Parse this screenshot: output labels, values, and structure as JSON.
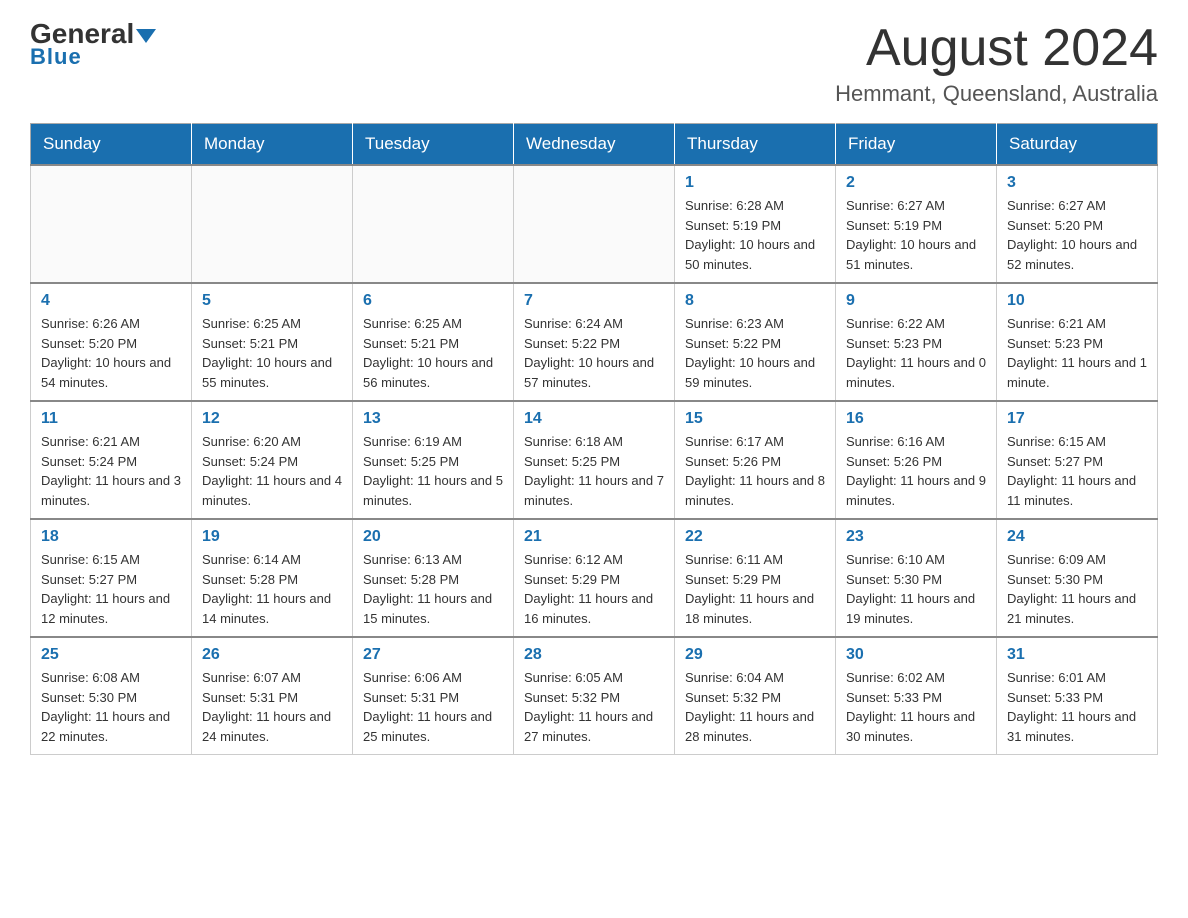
{
  "header": {
    "logo_general": "General",
    "logo_blue": "Blue",
    "month_title": "August 2024",
    "location": "Hemmant, Queensland, Australia"
  },
  "days_of_week": [
    "Sunday",
    "Monday",
    "Tuesday",
    "Wednesday",
    "Thursday",
    "Friday",
    "Saturday"
  ],
  "weeks": [
    [
      {
        "day": "",
        "sunrise": "",
        "sunset": "",
        "daylight": ""
      },
      {
        "day": "",
        "sunrise": "",
        "sunset": "",
        "daylight": ""
      },
      {
        "day": "",
        "sunrise": "",
        "sunset": "",
        "daylight": ""
      },
      {
        "day": "",
        "sunrise": "",
        "sunset": "",
        "daylight": ""
      },
      {
        "day": "1",
        "sunrise": "Sunrise: 6:28 AM",
        "sunset": "Sunset: 5:19 PM",
        "daylight": "Daylight: 10 hours and 50 minutes."
      },
      {
        "day": "2",
        "sunrise": "Sunrise: 6:27 AM",
        "sunset": "Sunset: 5:19 PM",
        "daylight": "Daylight: 10 hours and 51 minutes."
      },
      {
        "day": "3",
        "sunrise": "Sunrise: 6:27 AM",
        "sunset": "Sunset: 5:20 PM",
        "daylight": "Daylight: 10 hours and 52 minutes."
      }
    ],
    [
      {
        "day": "4",
        "sunrise": "Sunrise: 6:26 AM",
        "sunset": "Sunset: 5:20 PM",
        "daylight": "Daylight: 10 hours and 54 minutes."
      },
      {
        "day": "5",
        "sunrise": "Sunrise: 6:25 AM",
        "sunset": "Sunset: 5:21 PM",
        "daylight": "Daylight: 10 hours and 55 minutes."
      },
      {
        "day": "6",
        "sunrise": "Sunrise: 6:25 AM",
        "sunset": "Sunset: 5:21 PM",
        "daylight": "Daylight: 10 hours and 56 minutes."
      },
      {
        "day": "7",
        "sunrise": "Sunrise: 6:24 AM",
        "sunset": "Sunset: 5:22 PM",
        "daylight": "Daylight: 10 hours and 57 minutes."
      },
      {
        "day": "8",
        "sunrise": "Sunrise: 6:23 AM",
        "sunset": "Sunset: 5:22 PM",
        "daylight": "Daylight: 10 hours and 59 minutes."
      },
      {
        "day": "9",
        "sunrise": "Sunrise: 6:22 AM",
        "sunset": "Sunset: 5:23 PM",
        "daylight": "Daylight: 11 hours and 0 minutes."
      },
      {
        "day": "10",
        "sunrise": "Sunrise: 6:21 AM",
        "sunset": "Sunset: 5:23 PM",
        "daylight": "Daylight: 11 hours and 1 minute."
      }
    ],
    [
      {
        "day": "11",
        "sunrise": "Sunrise: 6:21 AM",
        "sunset": "Sunset: 5:24 PM",
        "daylight": "Daylight: 11 hours and 3 minutes."
      },
      {
        "day": "12",
        "sunrise": "Sunrise: 6:20 AM",
        "sunset": "Sunset: 5:24 PM",
        "daylight": "Daylight: 11 hours and 4 minutes."
      },
      {
        "day": "13",
        "sunrise": "Sunrise: 6:19 AM",
        "sunset": "Sunset: 5:25 PM",
        "daylight": "Daylight: 11 hours and 5 minutes."
      },
      {
        "day": "14",
        "sunrise": "Sunrise: 6:18 AM",
        "sunset": "Sunset: 5:25 PM",
        "daylight": "Daylight: 11 hours and 7 minutes."
      },
      {
        "day": "15",
        "sunrise": "Sunrise: 6:17 AM",
        "sunset": "Sunset: 5:26 PM",
        "daylight": "Daylight: 11 hours and 8 minutes."
      },
      {
        "day": "16",
        "sunrise": "Sunrise: 6:16 AM",
        "sunset": "Sunset: 5:26 PM",
        "daylight": "Daylight: 11 hours and 9 minutes."
      },
      {
        "day": "17",
        "sunrise": "Sunrise: 6:15 AM",
        "sunset": "Sunset: 5:27 PM",
        "daylight": "Daylight: 11 hours and 11 minutes."
      }
    ],
    [
      {
        "day": "18",
        "sunrise": "Sunrise: 6:15 AM",
        "sunset": "Sunset: 5:27 PM",
        "daylight": "Daylight: 11 hours and 12 minutes."
      },
      {
        "day": "19",
        "sunrise": "Sunrise: 6:14 AM",
        "sunset": "Sunset: 5:28 PM",
        "daylight": "Daylight: 11 hours and 14 minutes."
      },
      {
        "day": "20",
        "sunrise": "Sunrise: 6:13 AM",
        "sunset": "Sunset: 5:28 PM",
        "daylight": "Daylight: 11 hours and 15 minutes."
      },
      {
        "day": "21",
        "sunrise": "Sunrise: 6:12 AM",
        "sunset": "Sunset: 5:29 PM",
        "daylight": "Daylight: 11 hours and 16 minutes."
      },
      {
        "day": "22",
        "sunrise": "Sunrise: 6:11 AM",
        "sunset": "Sunset: 5:29 PM",
        "daylight": "Daylight: 11 hours and 18 minutes."
      },
      {
        "day": "23",
        "sunrise": "Sunrise: 6:10 AM",
        "sunset": "Sunset: 5:30 PM",
        "daylight": "Daylight: 11 hours and 19 minutes."
      },
      {
        "day": "24",
        "sunrise": "Sunrise: 6:09 AM",
        "sunset": "Sunset: 5:30 PM",
        "daylight": "Daylight: 11 hours and 21 minutes."
      }
    ],
    [
      {
        "day": "25",
        "sunrise": "Sunrise: 6:08 AM",
        "sunset": "Sunset: 5:30 PM",
        "daylight": "Daylight: 11 hours and 22 minutes."
      },
      {
        "day": "26",
        "sunrise": "Sunrise: 6:07 AM",
        "sunset": "Sunset: 5:31 PM",
        "daylight": "Daylight: 11 hours and 24 minutes."
      },
      {
        "day": "27",
        "sunrise": "Sunrise: 6:06 AM",
        "sunset": "Sunset: 5:31 PM",
        "daylight": "Daylight: 11 hours and 25 minutes."
      },
      {
        "day": "28",
        "sunrise": "Sunrise: 6:05 AM",
        "sunset": "Sunset: 5:32 PM",
        "daylight": "Daylight: 11 hours and 27 minutes."
      },
      {
        "day": "29",
        "sunrise": "Sunrise: 6:04 AM",
        "sunset": "Sunset: 5:32 PM",
        "daylight": "Daylight: 11 hours and 28 minutes."
      },
      {
        "day": "30",
        "sunrise": "Sunrise: 6:02 AM",
        "sunset": "Sunset: 5:33 PM",
        "daylight": "Daylight: 11 hours and 30 minutes."
      },
      {
        "day": "31",
        "sunrise": "Sunrise: 6:01 AM",
        "sunset": "Sunset: 5:33 PM",
        "daylight": "Daylight: 11 hours and 31 minutes."
      }
    ]
  ]
}
